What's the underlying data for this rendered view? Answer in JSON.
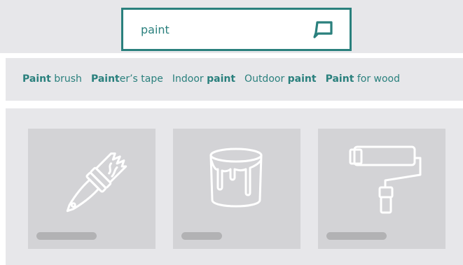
{
  "search": {
    "value": "paint",
    "button_icon": "search-submit-icon"
  },
  "suggestions": [
    {
      "pre": "",
      "bold": "Paint",
      "post": " brush"
    },
    {
      "pre": "",
      "bold": "Paint",
      "post": "er’s tape"
    },
    {
      "pre": "Indoor ",
      "bold": "paint",
      "post": ""
    },
    {
      "pre": "Outdoor ",
      "bold": "paint",
      "post": ""
    },
    {
      "pre": "",
      "bold": "Paint",
      "post": " for wood"
    }
  ],
  "products": [
    {
      "icon": "paint-brush-icon"
    },
    {
      "icon": "paint-can-icon"
    },
    {
      "icon": "paint-roller-icon"
    }
  ],
  "colors": {
    "accent": "#2a807d",
    "panel": "#e7e7ea",
    "card": "#d3d3d6",
    "placeholder": "#b2b2b4"
  }
}
